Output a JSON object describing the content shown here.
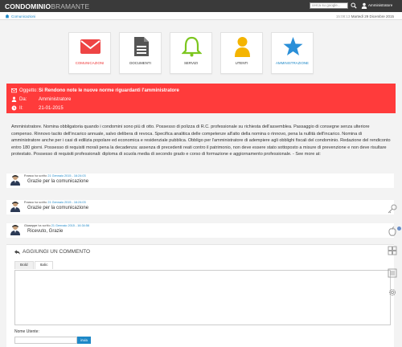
{
  "header": {
    "logo_bold": "CONDOMINIO",
    "logo_light": "BRAMANTE",
    "search_placeholder": "cerca su google...",
    "user_name": "Amministratore"
  },
  "breadcrumb": {
    "label": "Comunicazioni"
  },
  "datetime": {
    "time": "15:08:13",
    "date": "Martedì 29 Dicembre 2015"
  },
  "tiles": [
    {
      "label": "COMUNICAZIONI",
      "icon": "envelope-icon",
      "color": "#ee4444"
    },
    {
      "label": "DOCUMENTI",
      "icon": "document-icon",
      "color": "#555555"
    },
    {
      "label": "SERVIZI",
      "icon": "bell-icon",
      "color": "#7cc61f"
    },
    {
      "label": "UTENTI",
      "icon": "user-icon",
      "color": "#f4b400"
    },
    {
      "label": "AMMINISTRAZIONE",
      "icon": "star-icon",
      "color": "#2a8fd8"
    }
  ],
  "notice": {
    "oggetto_key": "Oggetto:",
    "oggetto_value": "Si Rendono note le nuove norme riguardanti l'amministratore",
    "da_key": "Da:",
    "da_value": "Amministratore",
    "il_key": "Il:",
    "il_value": "21-01-2015",
    "color": "#ff3b3b"
  },
  "body_text": "Amministratore. Nomina obbligatoria quando i condomini sono più di otto. Possesso di polizza di R.C. professionale su richiesta dell'assemblea. Passaggio di consegne senza ulteriore compenso. Rinnovo tacito dell'incarico annuale, salvo delibera di revoca. Specifica analitica delle competenze all'atto della nomina o rinnovo, pena la nullità dell'incarico. Nomina di amministratore anche per i casi di edilizia popolare ed economica e residenziale pubblica. Obbligo per l'amministratore di adempiere agli obblighi fiscali del condominio. Redazione del rendiconto entro 180 giorni. Possesso di requisiti morali pena la decadenza: assenza di precedenti reati contro il patrimonio, non deve essere stato sottoposto a misure di prevenzione e non deve risultare protestato. Possesso di requisiti professionali: diploma di scuola media di secondo grado e corso di formazione e aggiornamento professionale. - See more at:",
  "comments": [
    {
      "name": "Franco",
      "sep": " ha scritto ",
      "date": "21 Gennaio 2015 - 16:24:03",
      "text": "Grazie per la comunicazione"
    },
    {
      "name": "Franco",
      "sep": " ha scritto ",
      "date": "21 Gennaio 2015 - 16:24:03",
      "text": "Grazie per la comunicazione"
    },
    {
      "name": "Giuseppe",
      "sep": " ha scritto ",
      "date": "21 Gennaio 2015 - 16:34:56",
      "text": "Ricevuto, Grazie"
    }
  ],
  "compose": {
    "title": "AGGIUNGI UN COMMENTO",
    "tab_bold": "Bold",
    "tab_italic": "Italic",
    "name_label": "Nome Utente:",
    "submit_label": "invia"
  }
}
